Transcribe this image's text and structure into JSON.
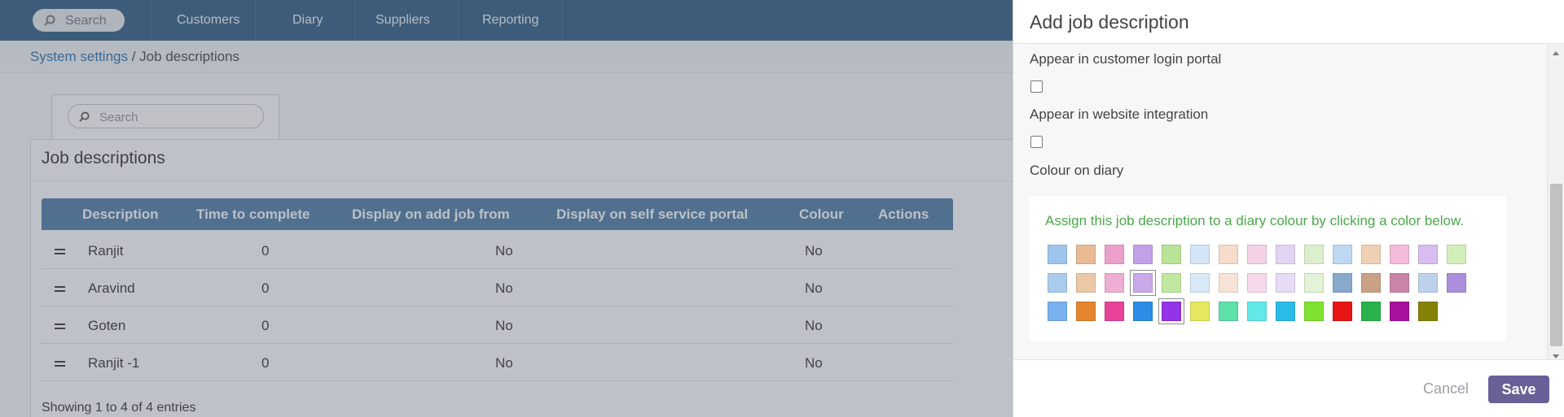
{
  "nav": {
    "search_label": "Search",
    "items": [
      "Customers",
      "Diary",
      "Suppliers",
      "Reporting"
    ]
  },
  "breadcrumb": {
    "parent": "System settings",
    "separator": " / ",
    "current": "Job descriptions"
  },
  "list": {
    "search_placeholder": "Search",
    "title": "Job descriptions",
    "columns": [
      "Description",
      "Time to complete",
      "Display on add job from",
      "Display on self service portal",
      "Colour",
      "Actions"
    ],
    "rows": [
      {
        "description": "Ranjit",
        "time": "0",
        "add_job": "No",
        "self_service": "No"
      },
      {
        "description": "Aravind",
        "time": "0",
        "add_job": "No",
        "self_service": "No"
      },
      {
        "description": "Goten",
        "time": "0",
        "add_job": "No",
        "self_service": "No"
      },
      {
        "description": "Ranjit -1",
        "time": "0",
        "add_job": "No",
        "self_service": "No"
      }
    ],
    "footer": "Showing 1 to 4 of 4 entries"
  },
  "modal": {
    "title": "Add job description",
    "field_customer_portal": "Appear in customer login portal",
    "field_website": "Appear in website integration",
    "field_colour": "Colour on diary",
    "colour_hint": "Assign this job description to a diary colour by clicking a color below.",
    "cancel_label": "Cancel",
    "save_label": "Save"
  },
  "colours": {
    "row1": [
      "#9ec5ec",
      "#e8bb94",
      "#ec9fcb",
      "#c3a1e8",
      "#b9e396",
      "#d3e5f7",
      "#f5dccb",
      "#f5d1e6",
      "#e2d4f5",
      "#dbefcd",
      "#bfd8f2",
      "#f0d0b5",
      "#f2bcd9",
      "#d8bdf0",
      "#d3efb9"
    ],
    "row2": [
      "#a9cbee",
      "#ebc8a6",
      "#eeaed2",
      "#c9aae9",
      "#c1e8a1",
      "#d9e9f8",
      "#f6e3d5",
      "#f6d9ea",
      "#e7dcf6",
      "#e2f3d7",
      "#88a8cc",
      "#c9a184",
      "#c985a7",
      "#bcd2ea",
      "#ab8fdc"
    ],
    "row3": [
      "#78b1ed",
      "#e4852f",
      "#e84398",
      "#2c8de6",
      "#9533e8",
      "#e6e660",
      "#5ee0a9",
      "#63e8e8",
      "#2bbbe8",
      "#7fe22e",
      "#e81515",
      "#2ab24c",
      "#a8119b",
      "#858208"
    ],
    "selected": [
      {
        "row": 2,
        "index": 4
      },
      {
        "row": 3,
        "index": 5
      }
    ],
    "accent_save": "#6a6098",
    "nav_bg": "#2f5b80",
    "table_header_bg": "#4d7aa1"
  }
}
